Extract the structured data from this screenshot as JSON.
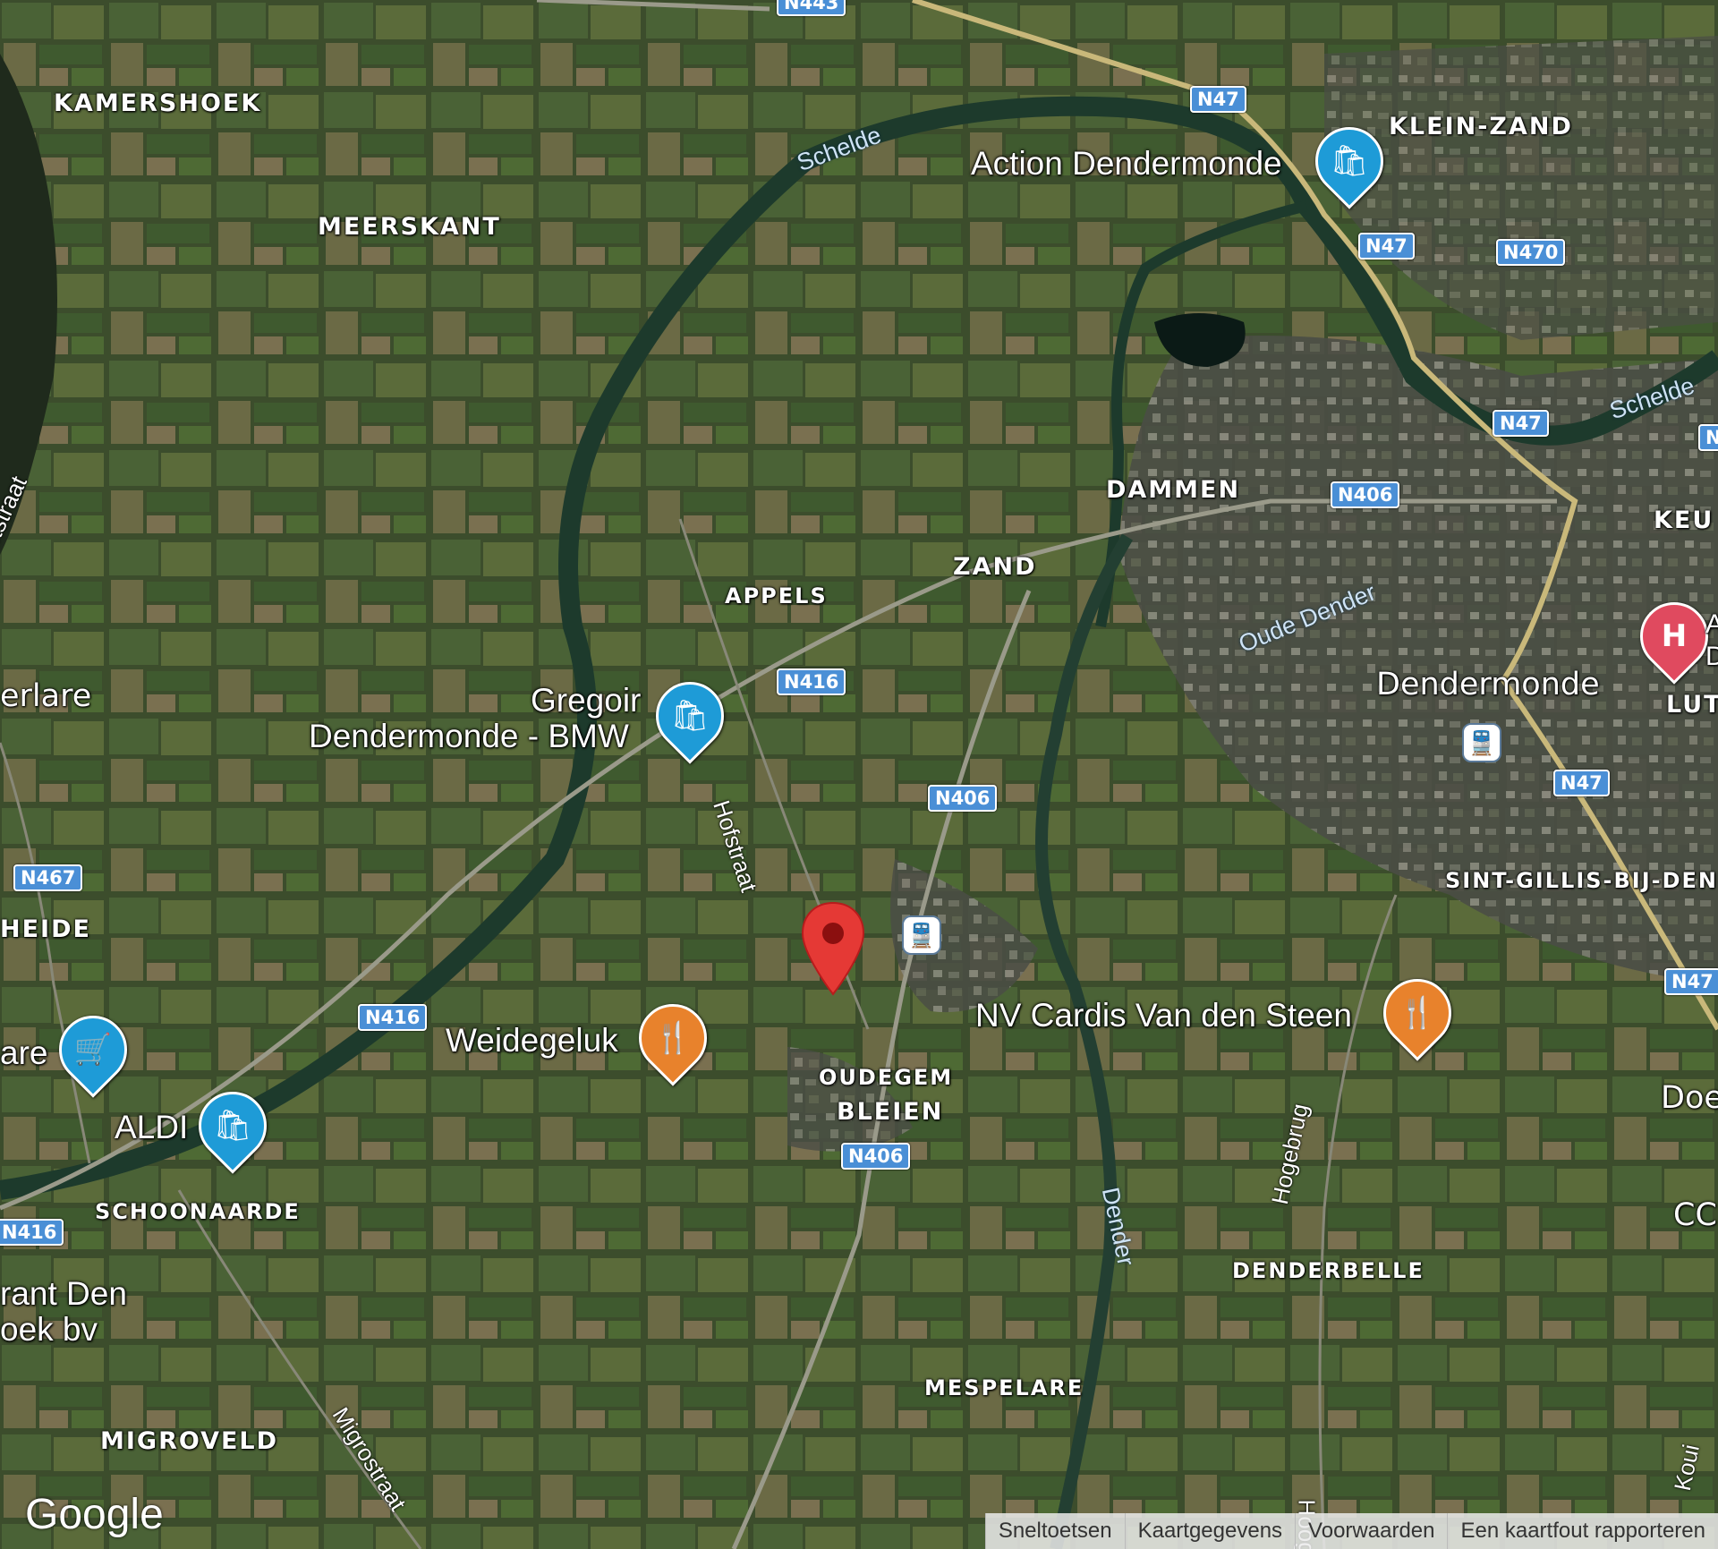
{
  "map_type": "satellite",
  "places": [
    {
      "id": "kamershoek",
      "text": "KAMERSHOEK"
    },
    {
      "id": "meerskant",
      "text": "MEERSKANT"
    },
    {
      "id": "klein-zand",
      "text": "KLEIN-ZAND"
    },
    {
      "id": "dammen",
      "text": "DAMMEN"
    },
    {
      "id": "keu",
      "text": "KEU"
    },
    {
      "id": "zand",
      "text": "ZAND"
    },
    {
      "id": "appels",
      "text": "APPELS"
    },
    {
      "id": "dendermonde",
      "text": "Dendermonde"
    },
    {
      "id": "lut",
      "text": "LUT"
    },
    {
      "id": "erlare",
      "text": "erlare"
    },
    {
      "id": "heide",
      "text": "HEIDE"
    },
    {
      "id": "sint-gillis",
      "text": "SINT-GILLIS-BIJ-DEND"
    },
    {
      "id": "oudegem",
      "text": "OUDEGEM"
    },
    {
      "id": "bleien",
      "text": "BLEIEN"
    },
    {
      "id": "schoonaarde",
      "text": "SCHOONAARDE"
    },
    {
      "id": "denderbelle",
      "text": "DENDERBELLE"
    },
    {
      "id": "mespelare",
      "text": "MESPELARE"
    },
    {
      "id": "migroveld",
      "text": "MIGROVELD"
    },
    {
      "id": "doe",
      "text": "Doe"
    },
    {
      "id": "cc",
      "text": "CC"
    }
  ],
  "pois": [
    {
      "id": "action",
      "label": "Action Dendermonde",
      "icon": "shopping-bag-icon",
      "color": "#1e9bd7"
    },
    {
      "id": "gregoir",
      "label1": "Gregoir",
      "label2": "Dendermonde - BMW",
      "icon": "shopping-bag-icon",
      "color": "#1e9bd7"
    },
    {
      "id": "weidegeluk",
      "label": "Weidegeluk",
      "icon": "fork-knife-icon",
      "color": "#e8822c"
    },
    {
      "id": "cardis",
      "label": "NV Cardis Van den Steen",
      "icon": "fork-knife-icon",
      "color": "#e8822c"
    },
    {
      "id": "aldi",
      "label": "ALDI",
      "icon": "shopping-bag-icon",
      "color": "#1e9bd7"
    },
    {
      "id": "are",
      "label": "are",
      "icon": "shopping-cart-icon",
      "color": "#1e9bd7"
    },
    {
      "id": "rant",
      "label1": "rant Den",
      "label2": "oek bv"
    },
    {
      "id": "hospital",
      "label1": "A",
      "label2": "D",
      "icon": "hospital-icon",
      "color": "#e04a5f"
    }
  ],
  "road_shields": [
    "N443",
    "N47",
    "N47",
    "N470",
    "N47",
    "N406",
    "N416",
    "N406",
    "N47",
    "N467",
    "N47",
    "N416",
    "N406",
    "N416",
    "N"
  ],
  "streets": [
    "Hofstraat",
    "putstraat",
    "Hogebrug",
    "Migrostraat",
    "Hoogs",
    "Koui"
  ],
  "rivers": [
    "Schelde",
    "Schelde",
    "Oude Dender",
    "Dender"
  ],
  "marker": {
    "label": "selected-location",
    "color": "#e53935"
  },
  "footer": {
    "links": [
      "Sneltoetsen",
      "Kaartgegevens",
      "Voorwaarden",
      "Een kaartfout rapporteren"
    ]
  },
  "branding": {
    "logo": "Google"
  }
}
